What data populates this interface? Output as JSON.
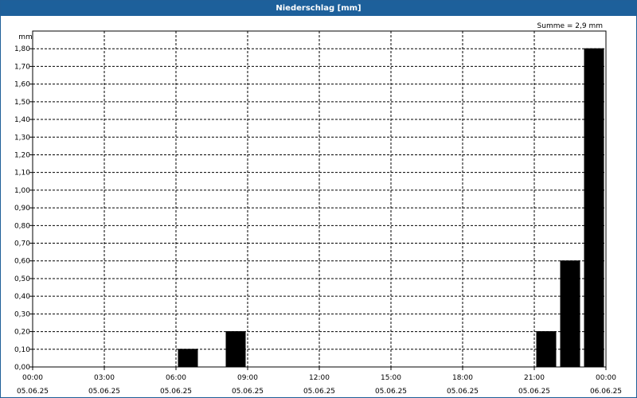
{
  "window": {
    "title": "Niederschlag [mm]"
  },
  "summary": {
    "text": "Summe = 2,9 mm"
  },
  "chart_data": {
    "type": "bar",
    "title": "Niederschlag [mm]",
    "ylabel": "mm",
    "xlabel": "",
    "ylim": [
      0,
      1.9
    ],
    "xlim_hours": [
      0,
      24
    ],
    "grid": true,
    "y_ticks": [
      0,
      0.1,
      0.2,
      0.3,
      0.4,
      0.5,
      0.6,
      0.7,
      0.8,
      0.9,
      1.0,
      1.1,
      1.2,
      1.3,
      1.4,
      1.5,
      1.6,
      1.7,
      1.8
    ],
    "y_tick_labels": [
      "0,00",
      "0,10",
      "0,20",
      "0,30",
      "0,40",
      "0,50",
      "0,60",
      "0,70",
      "0,80",
      "0,90",
      "1,00",
      "1,10",
      "1,20",
      "1,30",
      "1,40",
      "1,50",
      "1,60",
      "1,70",
      "1,80"
    ],
    "x_ticks": [
      {
        "time": "00:00",
        "date": "05.06.25"
      },
      {
        "time": "03:00",
        "date": "05.06.25"
      },
      {
        "time": "06:00",
        "date": "05.06.25"
      },
      {
        "time": "09:00",
        "date": "05.06.25"
      },
      {
        "time": "12:00",
        "date": "05.06.25"
      },
      {
        "time": "15:00",
        "date": "05.06.25"
      },
      {
        "time": "18:00",
        "date": "05.06.25"
      },
      {
        "time": "21:00",
        "date": "05.06.25"
      },
      {
        "time": "00:00",
        "date": "06.06.25"
      }
    ],
    "series": [
      {
        "color": "#000000",
        "points": [
          {
            "time": "07:00",
            "value": 0.1
          },
          {
            "time": "09:00",
            "value": 0.2
          },
          {
            "time": "22:00",
            "value": 0.2
          },
          {
            "time": "23:00",
            "value": 0.6
          },
          {
            "time": "00:00",
            "value": 1.8
          }
        ]
      }
    ],
    "total": 2.9
  }
}
